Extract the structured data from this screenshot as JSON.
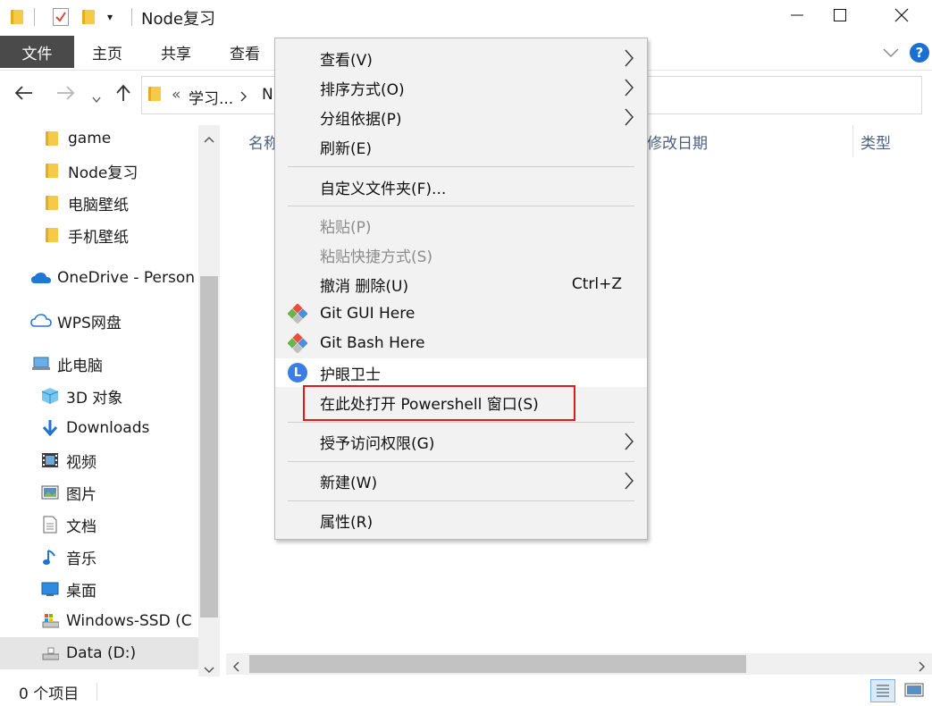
{
  "window": {
    "title": "Node复习",
    "minimize_icon": "minimize-icon",
    "maximize_icon": "maximize-icon",
    "close_icon": "close-icon"
  },
  "ribbon": {
    "file_tab": "文件",
    "tabs": [
      "主页",
      "共享",
      "查看"
    ],
    "help": "?"
  },
  "address": {
    "overflow": "«",
    "crumbs": [
      "学习...",
      "N"
    ]
  },
  "sidebar": {
    "items": [
      {
        "label": "game",
        "icon": "folder-icon"
      },
      {
        "label": "Node复习",
        "icon": "folder-icon"
      },
      {
        "label": "电脑壁纸",
        "icon": "folder-icon"
      },
      {
        "label": "手机壁纸",
        "icon": "folder-icon"
      },
      {
        "label": "OneDrive - Person",
        "icon": "onedrive-icon"
      },
      {
        "label": "WPS网盘",
        "icon": "cloud-icon"
      },
      {
        "label": "此电脑",
        "icon": "computer-icon"
      },
      {
        "label": "3D 对象",
        "icon": "cube-icon"
      },
      {
        "label": "Downloads",
        "icon": "download-icon"
      },
      {
        "label": "视频",
        "icon": "video-icon"
      },
      {
        "label": "图片",
        "icon": "picture-icon"
      },
      {
        "label": "文档",
        "icon": "document-icon"
      },
      {
        "label": "音乐",
        "icon": "music-icon"
      },
      {
        "label": "桌面",
        "icon": "desktop-icon"
      },
      {
        "label": "Windows-SSD (C",
        "icon": "drive-icon"
      },
      {
        "label": "Data (D:)",
        "icon": "drive-icon"
      }
    ]
  },
  "content": {
    "columns": [
      "名称",
      "修改日期",
      "类型"
    ]
  },
  "status": {
    "item_count": "0 个项目"
  },
  "context_menu": {
    "items": [
      {
        "label": "查看(V)",
        "submenu": true
      },
      {
        "label": "排序方式(O)",
        "submenu": true
      },
      {
        "label": "分组依据(P)",
        "submenu": true
      },
      {
        "label": "刷新(E)"
      },
      {
        "label": "自定义文件夹(F)..."
      },
      {
        "label": "粘贴(P)",
        "disabled": true
      },
      {
        "label": "粘贴快捷方式(S)",
        "disabled": true
      },
      {
        "label": "撤消 删除(U)",
        "shortcut": "Ctrl+Z"
      },
      {
        "label": "Git GUI Here",
        "icon": "git-icon"
      },
      {
        "label": "Git Bash Here",
        "icon": "git-icon"
      },
      {
        "label": "护眼卫士",
        "icon": "eye-care-icon",
        "icon_text": "L"
      },
      {
        "label": "在此处打开 Powershell 窗口(S)",
        "highlighted": true
      },
      {
        "label": "授予访问权限(G)",
        "submenu": true
      },
      {
        "label": "新建(W)",
        "submenu": true
      },
      {
        "label": "属性(R)"
      }
    ]
  },
  "colors": {
    "file_tab_bg": "#4a4a4a",
    "highlight_border": "#e0191c",
    "help_blue": "#1a6fd1",
    "folder_yellow": "#f7c948"
  }
}
